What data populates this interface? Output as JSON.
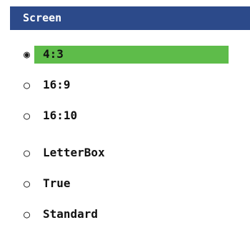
{
  "window": {
    "title": "Screen"
  },
  "options": [
    {
      "label": "4:3",
      "selected": true,
      "radio_glyph": "◉"
    },
    {
      "label": "16:9",
      "selected": false,
      "radio_glyph": "○"
    },
    {
      "label": "16:10",
      "selected": false,
      "radio_glyph": "○"
    },
    {
      "label": "LetterBox",
      "selected": false,
      "radio_glyph": "○"
    },
    {
      "label": "True",
      "selected": false,
      "radio_glyph": "○"
    },
    {
      "label": "Standard",
      "selected": false,
      "radio_glyph": "○"
    }
  ],
  "colors": {
    "title_bar": "#2c4a8a",
    "title_text": "#ffffff",
    "selection_highlight": "#5ebc4a",
    "text": "#111111"
  }
}
